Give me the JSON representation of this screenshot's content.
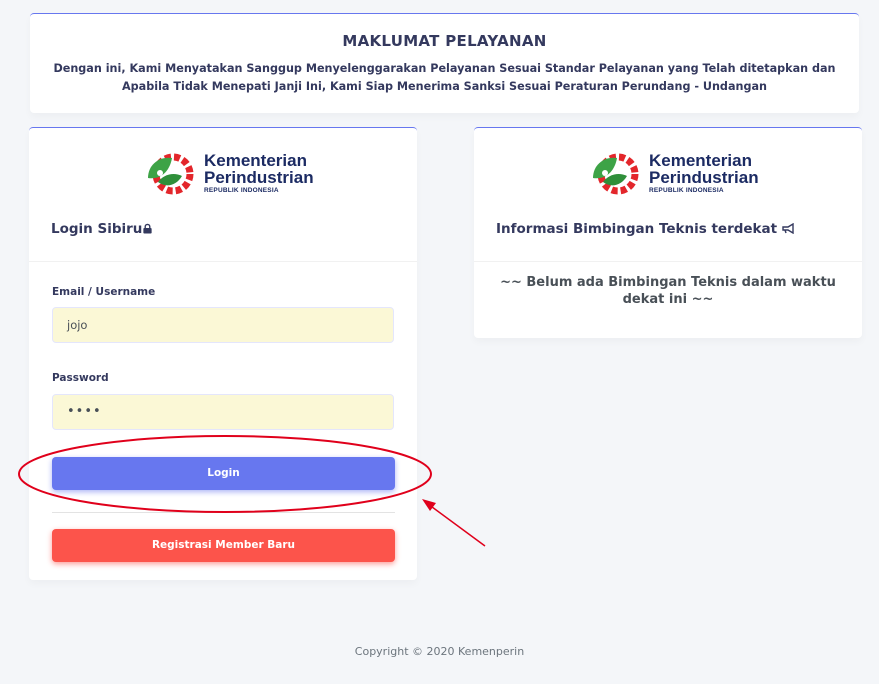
{
  "maklumat": {
    "title": "MAKLUMAT PELAYANAN",
    "text": "Dengan ini, Kami Menyatakan Sanggup Menyelenggarakan Pelayanan Sesuai Standar Pelayanan yang Telah ditetapkan dan Apabila Tidak Menepati Janji Ini, Kami Siap Menerima Sanksi Sesuai Peraturan Perundang - Undangan"
  },
  "logo": {
    "line1": "Kementerian",
    "line2": "Perindustrian",
    "line3": "REPUBLIK INDONESIA"
  },
  "login": {
    "header": "Login Sibiru",
    "header_icon": "lock-icon",
    "email_label": "Email / Username",
    "email_value": "jojo",
    "password_label": "Password",
    "password_value": "••••",
    "login_button": "Login",
    "register_button": "Registrasi Member Baru"
  },
  "info": {
    "header": "Informasi Bimbingan Teknis terdekat",
    "header_icon": "bullhorn-icon",
    "message": "~~ Belum ada Bimbingan Teknis dalam waktu dekat ini ~~"
  },
  "footer": {
    "copyright": "Copyright © 2020 Kemenperin"
  },
  "colors": {
    "primary": "#6777ef",
    "danger": "#fc544b",
    "input_bg": "#fbf8d6",
    "annotation": "#e0001b"
  }
}
